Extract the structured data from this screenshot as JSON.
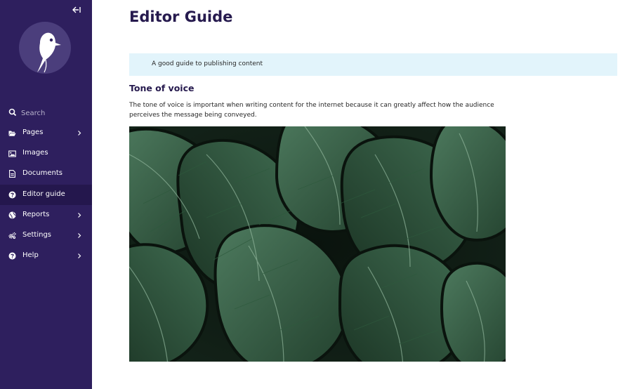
{
  "sidebar": {
    "collapse_label": "Collapse sidebar",
    "search_placeholder": "Search",
    "items": [
      {
        "label": "Pages",
        "icon": "folder-open-icon",
        "has_children": true,
        "active": false
      },
      {
        "label": "Images",
        "icon": "image-icon",
        "has_children": false,
        "active": false
      },
      {
        "label": "Documents",
        "icon": "document-icon",
        "has_children": false,
        "active": false
      },
      {
        "label": "Editor guide",
        "icon": "help-circle-icon",
        "has_children": false,
        "active": true
      },
      {
        "label": "Reports",
        "icon": "globe-icon",
        "has_children": true,
        "active": false
      },
      {
        "label": "Settings",
        "icon": "cogs-icon",
        "has_children": true,
        "active": false
      },
      {
        "label": "Help",
        "icon": "help-circle-icon",
        "has_children": true,
        "active": false
      }
    ]
  },
  "main": {
    "title": "Editor Guide",
    "intro": "A good guide to publishing content",
    "section_heading": "Tone of voice",
    "section_body": "The tone of voice is important when writing content for the internet because it can greatly affect how the audience perceives the message being conveyed.",
    "image_subject": "monstera leaves photo"
  },
  "colors": {
    "sidebar_bg": "#2e1f5e",
    "sidebar_active_bg": "#24174d",
    "heading": "#261a4e",
    "info_box": "#e2f4fb"
  }
}
